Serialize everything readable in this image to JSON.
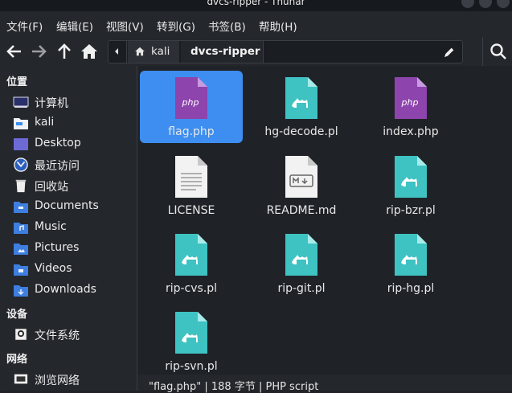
{
  "window": {
    "title": "dvcs-ripper - Thunar"
  },
  "menu": [
    "文件(F)",
    "编辑(E)",
    "视图(V)",
    "转到(G)",
    "书签(B)",
    "帮助(H)"
  ],
  "toolbar": {
    "icons": [
      "arrow-left-icon",
      "arrow-right-icon",
      "arrow-up-icon",
      "home-icon",
      "chevron-left-icon",
      "edit-pencil-icon",
      "search-icon"
    ]
  },
  "path": {
    "crumbs": [
      "kali",
      "dvcs-ripper"
    ]
  },
  "sidebar": {
    "sections": [
      {
        "title": "位置",
        "items": [
          {
            "label": "计算机",
            "icon": "computer-icon"
          },
          {
            "label": "kali",
            "icon": "home-folder-icon"
          },
          {
            "label": "Desktop",
            "icon": "desktop-folder-icon"
          },
          {
            "label": "最近访问",
            "icon": "recent-icon"
          },
          {
            "label": "回收站",
            "icon": "trash-icon"
          },
          {
            "label": "Documents",
            "icon": "documents-folder-icon"
          },
          {
            "label": "Music",
            "icon": "music-folder-icon"
          },
          {
            "label": "Pictures",
            "icon": "pictures-folder-icon"
          },
          {
            "label": "Videos",
            "icon": "videos-folder-icon"
          },
          {
            "label": "Downloads",
            "icon": "downloads-folder-icon"
          }
        ]
      },
      {
        "title": "设备",
        "items": [
          {
            "label": "文件系统",
            "icon": "drive-icon"
          }
        ]
      },
      {
        "title": "网络",
        "items": [
          {
            "label": "浏览网络",
            "icon": "network-icon"
          }
        ]
      }
    ]
  },
  "files": [
    {
      "name": "flag.php",
      "type": "php",
      "selected": true
    },
    {
      "name": "hg-decode.pl",
      "type": "perl"
    },
    {
      "name": "index.php",
      "type": "php"
    },
    {
      "name": "LICENSE",
      "type": "text"
    },
    {
      "name": "README.md",
      "type": "markdown"
    },
    {
      "name": "rip-bzr.pl",
      "type": "perl"
    },
    {
      "name": "rip-cvs.pl",
      "type": "perl"
    },
    {
      "name": "rip-git.pl",
      "type": "perl"
    },
    {
      "name": "rip-hg.pl",
      "type": "perl"
    },
    {
      "name": "rip-svn.pl",
      "type": "perl"
    }
  ],
  "status": "\"flag.php\" | 188 字节 | PHP script",
  "colors": {
    "accent": "#3d8ef0",
    "php": "#8e44ad",
    "perl": "#3fc2c2"
  }
}
